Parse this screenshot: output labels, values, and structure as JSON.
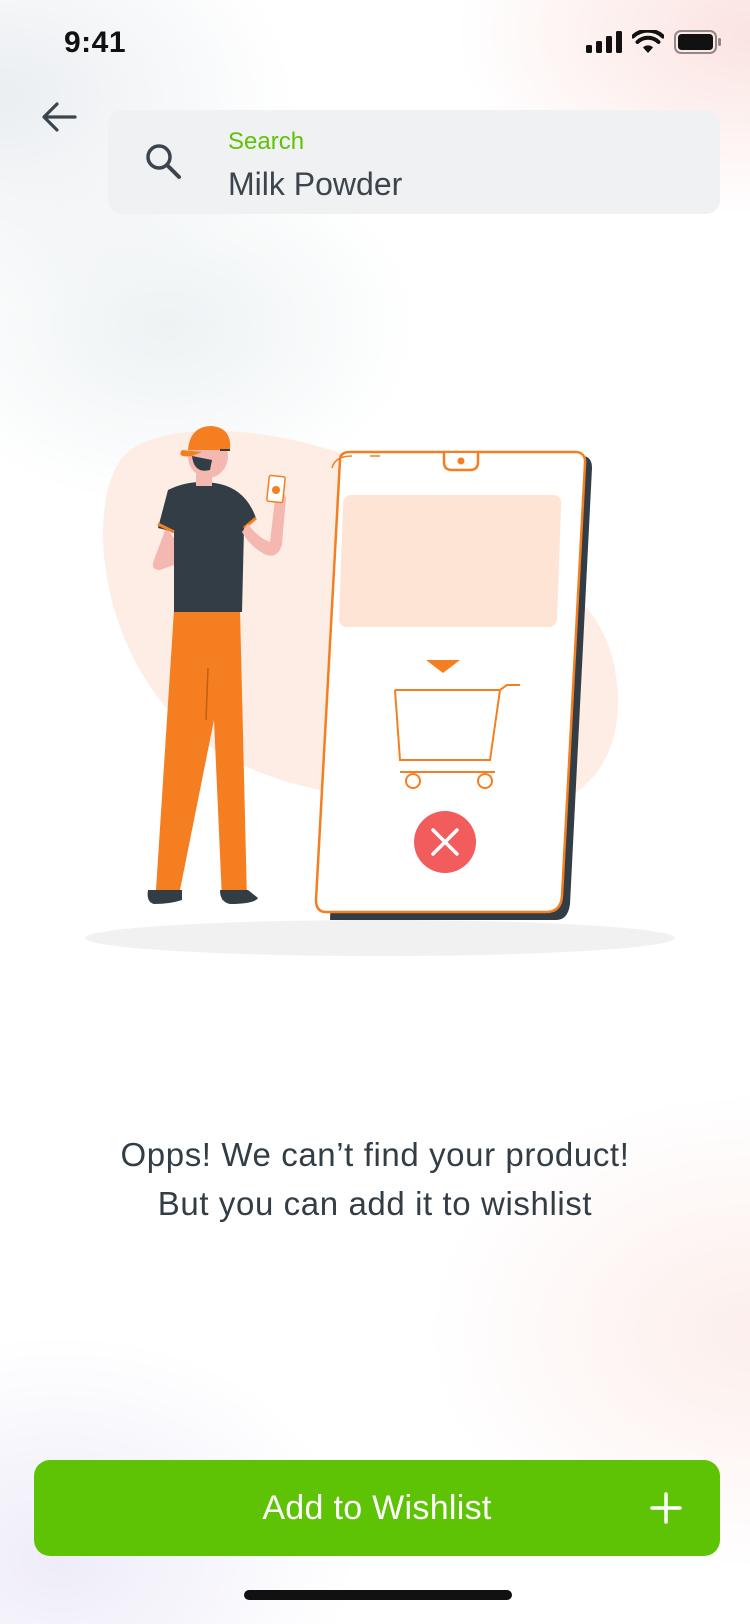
{
  "status_bar": {
    "time": "9:41",
    "icons": [
      "signal-icon",
      "wifi-icon",
      "battery-icon"
    ]
  },
  "header": {
    "back_icon": "arrow-left-icon",
    "search": {
      "icon": "search-icon",
      "label": "Search",
      "value": "Milk Powder"
    }
  },
  "empty_state": {
    "line1": "Opps! We can’t find your product!",
    "line2": "But you can add it to wishlist"
  },
  "cta": {
    "label": "Add to Wishlist",
    "icon": "plus-icon"
  },
  "colors": {
    "accent_green": "#5ec304",
    "illustration_orange": "#f57f20",
    "error_red": "#f25c5c",
    "text_dark": "#333d45"
  }
}
